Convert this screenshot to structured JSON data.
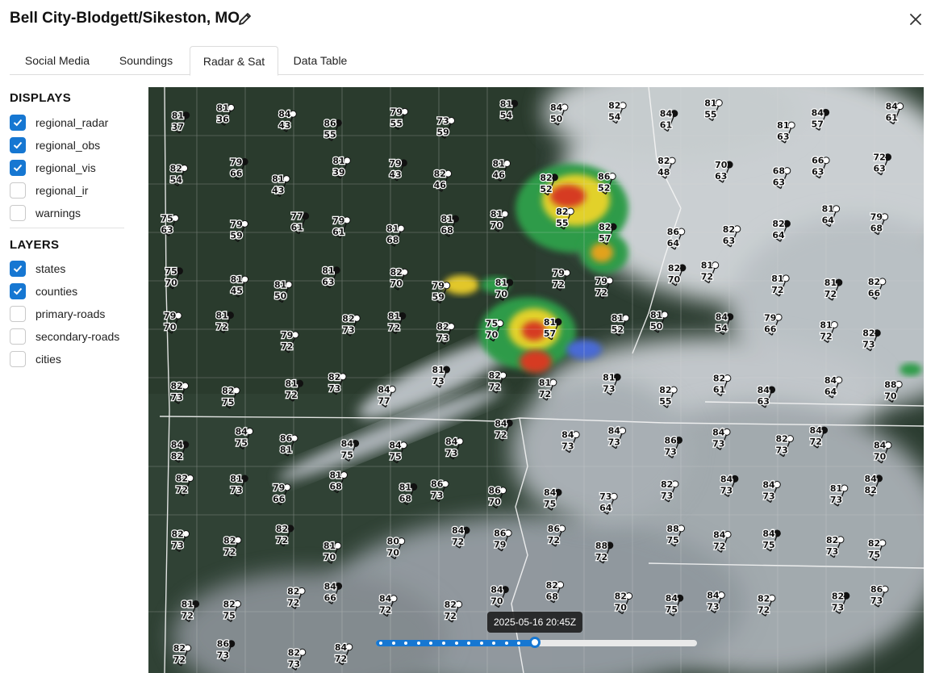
{
  "header": {
    "title": "Bell City-Blodgett/Sikeston, MO"
  },
  "tabs": [
    {
      "label": "Social Media",
      "active": false
    },
    {
      "label": "Soundings",
      "active": false
    },
    {
      "label": "Radar & Sat",
      "active": true
    },
    {
      "label": "Data Table",
      "active": false
    }
  ],
  "displays": {
    "title": "DISPLAYS",
    "options": [
      {
        "label": "regional_radar",
        "checked": true
      },
      {
        "label": "regional_obs",
        "checked": true
      },
      {
        "label": "regional_vis",
        "checked": true
      },
      {
        "label": "regional_ir",
        "checked": false
      },
      {
        "label": "warnings",
        "checked": false
      }
    ]
  },
  "layers": {
    "title": "LAYERS",
    "options": [
      {
        "label": "states",
        "checked": true
      },
      {
        "label": "counties",
        "checked": true
      },
      {
        "label": "primary-roads",
        "checked": false
      },
      {
        "label": "secondary-roads",
        "checked": false
      },
      {
        "label": "cities",
        "checked": false
      }
    ]
  },
  "timeline": {
    "timestamp": "2025-05-16 20:45Z",
    "frame_count": 13,
    "current_frame": 13,
    "progress_fraction": 0.5
  },
  "colors": {
    "accent": "#1677d2",
    "checkbox_checked": "#1677d2"
  },
  "icons": {
    "edit": "pencil-icon",
    "close": "close-icon",
    "checkmark": "check-icon"
  },
  "station_obs": [
    {
      "t": "81",
      "d": "37"
    },
    {
      "t": "81",
      "d": "36"
    },
    {
      "t": "84",
      "d": "43"
    },
    {
      "t": "86",
      "d": "55"
    },
    {
      "t": "79",
      "d": "55"
    },
    {
      "t": "73",
      "d": "59"
    },
    {
      "t": "81",
      "d": "54"
    },
    {
      "t": "84",
      "d": "50"
    },
    {
      "t": "82",
      "d": "54"
    },
    {
      "t": "84",
      "d": "61"
    },
    {
      "t": "81",
      "d": "55"
    },
    {
      "t": "81",
      "d": "63"
    },
    {
      "t": "84",
      "d": "57"
    },
    {
      "t": "84",
      "d": "61"
    },
    {
      "t": "82",
      "d": "54"
    },
    {
      "t": "79",
      "d": "66"
    },
    {
      "t": "81",
      "d": "43"
    },
    {
      "t": "81",
      "d": "39"
    },
    {
      "t": "79",
      "d": "43"
    },
    {
      "t": "82",
      "d": "46"
    },
    {
      "t": "81",
      "d": "46"
    },
    {
      "t": "82",
      "d": "52"
    },
    {
      "t": "86",
      "d": "52"
    },
    {
      "t": "82",
      "d": "48"
    },
    {
      "t": "70",
      "d": "63"
    },
    {
      "t": "68",
      "d": "63"
    },
    {
      "t": "66",
      "d": "63"
    },
    {
      "t": "72",
      "d": "63"
    },
    {
      "t": "75",
      "d": "63"
    },
    {
      "t": "79",
      "d": "59"
    },
    {
      "t": "77",
      "d": "61"
    },
    {
      "t": "79",
      "d": "61"
    },
    {
      "t": "81",
      "d": "68"
    },
    {
      "t": "81",
      "d": "68"
    },
    {
      "t": "81",
      "d": "70"
    },
    {
      "t": "82",
      "d": "55"
    },
    {
      "t": "82",
      "d": "57"
    },
    {
      "t": "86",
      "d": "64"
    },
    {
      "t": "82",
      "d": "63"
    },
    {
      "t": "82",
      "d": "64"
    },
    {
      "t": "81",
      "d": "64"
    },
    {
      "t": "79",
      "d": "68"
    },
    {
      "t": "75",
      "d": "70"
    },
    {
      "t": "81",
      "d": "45"
    },
    {
      "t": "81",
      "d": "50"
    },
    {
      "t": "81",
      "d": "63"
    },
    {
      "t": "82",
      "d": "70"
    },
    {
      "t": "79",
      "d": "59"
    },
    {
      "t": "81",
      "d": "70"
    },
    {
      "t": "79",
      "d": "72"
    },
    {
      "t": "79",
      "d": "72"
    },
    {
      "t": "82",
      "d": "70"
    },
    {
      "t": "81",
      "d": "72"
    },
    {
      "t": "81",
      "d": "72"
    },
    {
      "t": "81",
      "d": "72"
    },
    {
      "t": "82",
      "d": "66"
    },
    {
      "t": "79",
      "d": "70"
    },
    {
      "t": "81",
      "d": "72"
    },
    {
      "t": "79",
      "d": "72"
    },
    {
      "t": "82",
      "d": "73"
    },
    {
      "t": "81",
      "d": "72"
    },
    {
      "t": "82",
      "d": "73"
    },
    {
      "t": "75",
      "d": "70"
    },
    {
      "t": "81",
      "d": "57"
    },
    {
      "t": "81",
      "d": "52"
    },
    {
      "t": "81",
      "d": "50"
    },
    {
      "t": "84",
      "d": "54"
    },
    {
      "t": "79",
      "d": "66"
    },
    {
      "t": "81",
      "d": "72"
    },
    {
      "t": "82",
      "d": "73"
    },
    {
      "t": "82",
      "d": "73"
    },
    {
      "t": "82",
      "d": "75"
    },
    {
      "t": "81",
      "d": "72"
    },
    {
      "t": "82",
      "d": "73"
    },
    {
      "t": "84",
      "d": "77"
    },
    {
      "t": "81",
      "d": "73"
    },
    {
      "t": "82",
      "d": "72"
    },
    {
      "t": "81",
      "d": "72"
    },
    {
      "t": "81",
      "d": "73"
    },
    {
      "t": "82",
      "d": "55"
    },
    {
      "t": "82",
      "d": "61"
    },
    {
      "t": "84",
      "d": "63"
    },
    {
      "t": "84",
      "d": "64"
    },
    {
      "t": "88",
      "d": "70"
    },
    {
      "t": "84",
      "d": "82"
    },
    {
      "t": "84",
      "d": "75"
    },
    {
      "t": "86",
      "d": "81"
    },
    {
      "t": "84",
      "d": "75"
    },
    {
      "t": "84",
      "d": "75"
    },
    {
      "t": "84",
      "d": "73"
    },
    {
      "t": "84",
      "d": "72"
    },
    {
      "t": "84",
      "d": "73"
    },
    {
      "t": "84",
      "d": "73"
    },
    {
      "t": "86",
      "d": "73"
    },
    {
      "t": "84",
      "d": "73"
    },
    {
      "t": "82",
      "d": "73"
    },
    {
      "t": "84",
      "d": "72"
    },
    {
      "t": "84",
      "d": "70"
    },
    {
      "t": "82",
      "d": "72"
    },
    {
      "t": "81",
      "d": "73"
    },
    {
      "t": "79",
      "d": "66"
    },
    {
      "t": "81",
      "d": "68"
    },
    {
      "t": "81",
      "d": "68"
    },
    {
      "t": "86",
      "d": "73"
    },
    {
      "t": "86",
      "d": "70"
    },
    {
      "t": "84",
      "d": "75"
    },
    {
      "t": "73",
      "d": "64"
    },
    {
      "t": "82",
      "d": "73"
    },
    {
      "t": "84",
      "d": "73"
    },
    {
      "t": "84",
      "d": "73"
    },
    {
      "t": "81",
      "d": "73"
    },
    {
      "t": "84",
      "d": "82"
    },
    {
      "t": "82",
      "d": "73"
    },
    {
      "t": "82",
      "d": "72"
    },
    {
      "t": "82",
      "d": "72"
    },
    {
      "t": "81",
      "d": "70"
    },
    {
      "t": "80",
      "d": "70"
    },
    {
      "t": "84",
      "d": "72"
    },
    {
      "t": "86",
      "d": "79"
    },
    {
      "t": "86",
      "d": "72"
    },
    {
      "t": "88",
      "d": "72"
    },
    {
      "t": "88",
      "d": "75"
    },
    {
      "t": "84",
      "d": "72"
    },
    {
      "t": "84",
      "d": "75"
    },
    {
      "t": "82",
      "d": "73"
    },
    {
      "t": "82",
      "d": "75"
    },
    {
      "t": "81",
      "d": "72"
    },
    {
      "t": "82",
      "d": "75"
    },
    {
      "t": "82",
      "d": "72"
    },
    {
      "t": "84",
      "d": "66"
    },
    {
      "t": "84",
      "d": "72"
    },
    {
      "t": "82",
      "d": "72"
    },
    {
      "t": "84",
      "d": "70"
    },
    {
      "t": "82",
      "d": "68"
    },
    {
      "t": "82",
      "d": "70"
    },
    {
      "t": "84",
      "d": "75"
    },
    {
      "t": "84",
      "d": "73"
    },
    {
      "t": "82",
      "d": "72"
    },
    {
      "t": "82",
      "d": "73"
    },
    {
      "t": "86",
      "d": "73"
    },
    {
      "t": "82",
      "d": "72"
    },
    {
      "t": "86",
      "d": "73"
    },
    {
      "t": "82",
      "d": "73"
    },
    {
      "t": "84",
      "d": "72"
    }
  ]
}
